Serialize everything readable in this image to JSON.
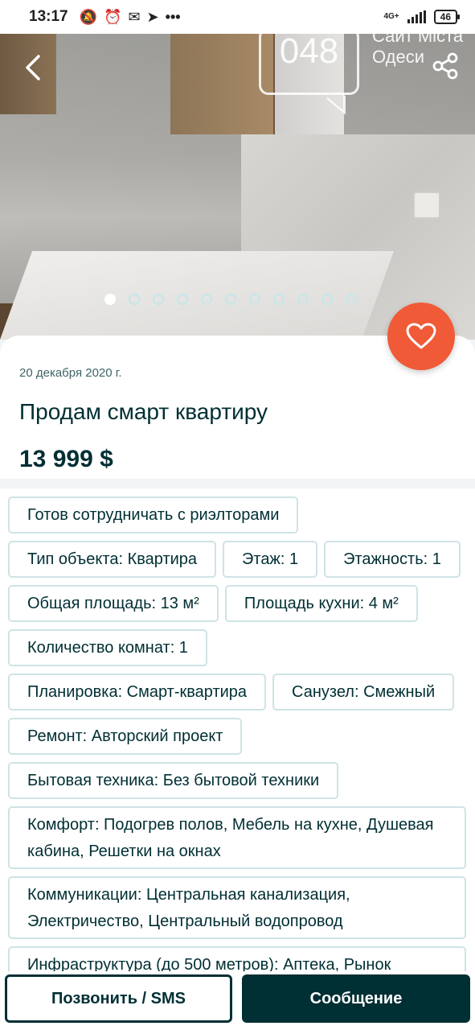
{
  "status_bar": {
    "time": "13:17",
    "network": "4G+",
    "battery": "46"
  },
  "watermark": {
    "number": "048",
    "text_line1": "Сайт Міста",
    "text_line2": "Одеси"
  },
  "gallery": {
    "total": 11,
    "active_index": 0
  },
  "listing": {
    "date": "20 декабря 2020 г.",
    "title": "Продам смарт квартиру",
    "price": "13 999 $"
  },
  "tags": [
    "Готов сотрудничать с риэлторами",
    "Тип объекта: Квартира",
    "Этаж: 1",
    "Этажность: 1",
    "Общая площадь: 13 м²",
    "Площадь кухни: 4 м²",
    "Количество комнат: 1",
    "Планировка: Смарт-квартира",
    "Санузел: Смежный",
    "Ремонт: Авторский проект",
    "Бытовая техника: Без бытовой техники"
  ],
  "tags_wide": [
    "Комфорт: Подогрев полов, Мебель на кухне, Душевая кабина, Решетки на окнах",
    "Коммуникации: Центральная канализация, Электричество, Центральный водопровод",
    "Инфраструктура (до 500 метров): Аптека, Рынок"
  ],
  "actions": {
    "call_label": "Позвонить / SMS",
    "message_label": "Сообщение"
  },
  "colors": {
    "primary": "#002f34",
    "favorite": "#f05a37",
    "tag_border": "#cfe3e6"
  }
}
